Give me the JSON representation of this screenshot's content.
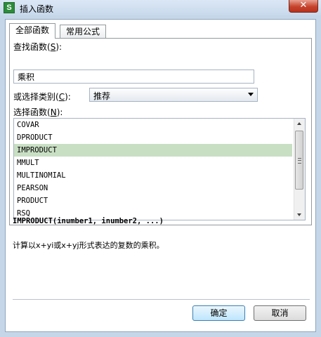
{
  "window": {
    "title": "插入函数",
    "icon": "spreadsheet-app-icon",
    "close_glyph": "✕"
  },
  "tabs": [
    {
      "label": "全部函数",
      "active": true
    },
    {
      "label": "常用公式",
      "active": false
    }
  ],
  "search": {
    "label": "查找函数",
    "hotkey": "S",
    "value": "乘积"
  },
  "category": {
    "label": "或选择类别",
    "hotkey": "C",
    "selected": "推荐"
  },
  "function_list": {
    "label": "选择函数",
    "hotkey": "N",
    "items": [
      "COVAR",
      "DPRODUCT",
      "IMPRODUCT",
      "MMULT",
      "MULTINOMIAL",
      "PEARSON",
      "PRODUCT",
      "RSQ"
    ],
    "selected_item": "IMPRODUCT"
  },
  "details": {
    "signature": "IMPRODUCT(inumber1, inumber2, ...)",
    "description": "计算以x+yi或x+yj形式表达的复数的乘积。"
  },
  "buttons": {
    "ok": "确定",
    "cancel": "取消"
  },
  "colors": {
    "selection": "#c9dfc4",
    "titlebar": "#c8d9ec",
    "close_button": "#c7432c"
  }
}
